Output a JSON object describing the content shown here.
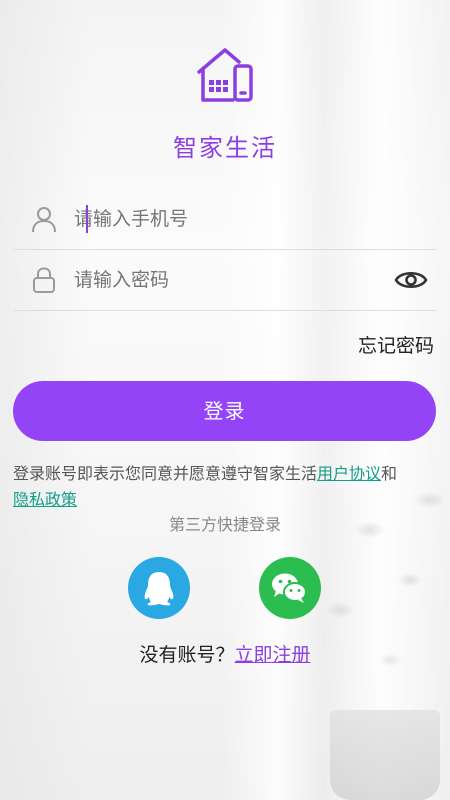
{
  "app": {
    "name": "智家生活",
    "accent_color": "#9444f7",
    "link_color": "#139d8a",
    "logo_icon": "smart-home-icon"
  },
  "phone": {
    "placeholder": "请输入手机号",
    "icon": "user-icon"
  },
  "password": {
    "placeholder": "请输入密码",
    "icon": "lock-icon",
    "toggle_icon": "eye-icon"
  },
  "forgot_password": "忘记密码",
  "login_button": "登录",
  "agreement": {
    "prefix": "登录账号即表示您同意并愿意遵守智家生活",
    "user_agreement": "用户协议",
    "conjunction": "和",
    "privacy_policy": "隐私政策"
  },
  "third_party": {
    "title": "第三方快捷登录",
    "providers": [
      {
        "name": "qq",
        "icon": "qq-icon",
        "color": "#29a8e3"
      },
      {
        "name": "wechat",
        "icon": "wechat-icon",
        "color": "#2bbd4f"
      }
    ]
  },
  "register": {
    "prompt": "没有账号？",
    "link": "立即注册"
  }
}
